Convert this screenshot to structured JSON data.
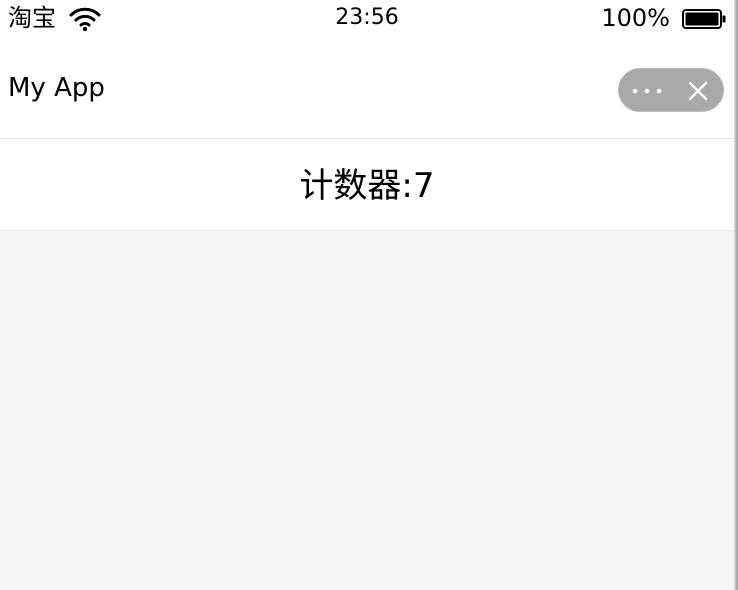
{
  "status_bar": {
    "carrier": "淘宝",
    "time": "23:56",
    "battery_percent": "100%",
    "battery_level": 1.0
  },
  "nav": {
    "title": "My App",
    "more_icon": "more-dots-icon",
    "close_icon": "close-icon"
  },
  "counter": {
    "label": "计数器:",
    "value": "7"
  },
  "colors": {
    "capsule": "#a9a9a9",
    "page_background": "#f5f5f5",
    "bar_background": "#ffffff"
  }
}
